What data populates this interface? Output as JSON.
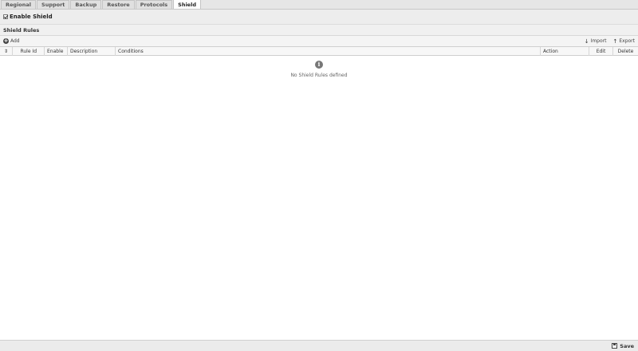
{
  "tabs": [
    {
      "label": "Regional"
    },
    {
      "label": "Support"
    },
    {
      "label": "Backup"
    },
    {
      "label": "Restore"
    },
    {
      "label": "Protocols"
    },
    {
      "label": "Shield",
      "active": true
    }
  ],
  "enable_shield": {
    "label": "Enable Shield",
    "checked": true
  },
  "section": {
    "title": "Shield Rules"
  },
  "toolbar": {
    "add_label": "Add",
    "import_label": "Import",
    "export_label": "Export"
  },
  "table": {
    "columns": {
      "sort": "⇕",
      "rule_id": "Rule Id",
      "enable": "Enable",
      "description": "Description",
      "conditions": "Conditions",
      "action": "Action",
      "edit": "Edit",
      "delete": "Delete"
    },
    "rows": [],
    "empty_message": "No Shield Rules defined"
  },
  "footer": {
    "save_label": "Save"
  }
}
